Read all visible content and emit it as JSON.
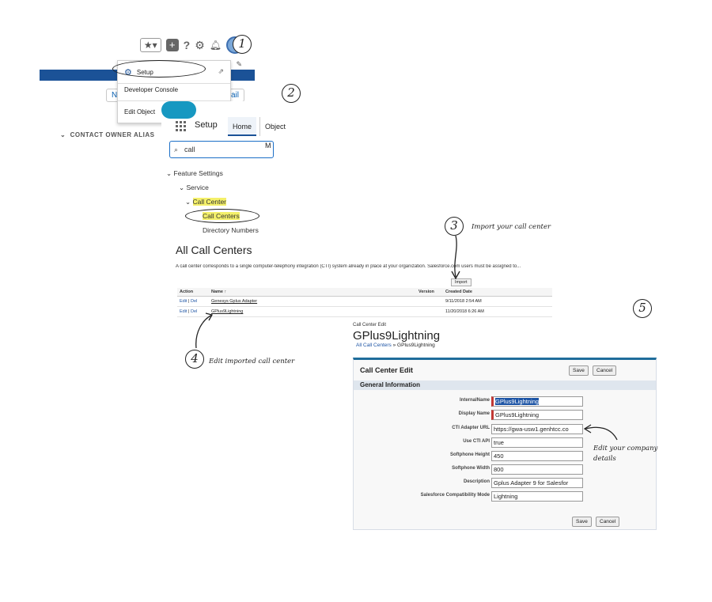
{
  "panel1": {
    "toolbar": {
      "favorites_icon": "star-icon",
      "add_icon": "plus-icon",
      "help_glyph": "?",
      "setup_icon": "gear-icon",
      "notifications_icon": "bell-icon"
    },
    "menu": {
      "setup": "Setup",
      "developer_console": "Developer Console",
      "edit_object": "Edit Object"
    },
    "bg_buttons": {
      "new": "New",
      "email": "Email"
    },
    "column_header": "CONTACT OWNER ALIAS"
  },
  "panel2": {
    "app_name": "Setup",
    "tabs": [
      "Home",
      "Object M"
    ],
    "search_value": "call",
    "tree": {
      "feature_settings": "Feature Settings",
      "service": "Service",
      "call_center": "Call Center",
      "call_centers": "Call Centers",
      "directory_numbers": "Directory Numbers"
    }
  },
  "panel3": {
    "title": "All Call Centers",
    "description": "A call center corresponds to a single computer-telephony integration (CTI) system already in place at your organization. Salesforce.com users must be assigned to...",
    "import_label": "Import",
    "columns": {
      "action": "Action",
      "name": "Name ↑",
      "version": "Version",
      "created": "Created Date"
    },
    "rows": [
      {
        "edit": "Edit",
        "del": "Del",
        "name": "Genesys Gplus Adapter",
        "version": "",
        "created": "9/11/2018 2:54 AM"
      },
      {
        "edit": "Edit",
        "del": "Del",
        "name": "GPlus9Lightning",
        "version": "",
        "created": "11/20/2018 6:26 AM"
      }
    ]
  },
  "panel5": {
    "crumb_top": "Call Center Edit",
    "title": "GPlus9Lightning",
    "crumb_link": "All Call Centers",
    "crumb_sep": "»",
    "crumb_current": "GPlus9Lightning",
    "box_title": "Call Center Edit",
    "save": "Save",
    "cancel": "Cancel",
    "section": "General Information",
    "fields": [
      {
        "label": "InternalName",
        "value": "GPlus9Lightning"
      },
      {
        "label": "Display Name",
        "value": "GPlus9Lightning"
      },
      {
        "label": "CTI Adapter URL",
        "value": "https://gwa-usw1.genhtcc.co"
      },
      {
        "label": "Use CTI API",
        "value": "true"
      },
      {
        "label": "Softphone Height",
        "value": "450"
      },
      {
        "label": "Softphone Width",
        "value": "800"
      },
      {
        "label": "Description",
        "value": "Gplus Adapter 9 for Salesfor"
      },
      {
        "label": "Salesforce Compatibility Mode",
        "value": "Lightning"
      }
    ]
  },
  "annotations": {
    "step1": "1",
    "step2": "2",
    "step3": "3",
    "step4": "4",
    "step5": "5",
    "import_note": "Import your call center",
    "edit_note": "Edit imported call center",
    "company_note_1": "Edit your company",
    "company_note_2": "details"
  },
  "colors": {
    "salesforce_blue": "#1b5297",
    "link_blue": "#1e55a5",
    "required_red": "#c23934",
    "highlight_yellow": "#f4f06a"
  }
}
